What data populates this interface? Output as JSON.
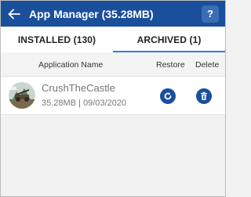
{
  "header": {
    "title": "App Manager (35.28MB)",
    "help_label": "?",
    "back_icon": "arrow-left-icon"
  },
  "tabs": [
    {
      "label": "INSTALLED (130)",
      "active": false
    },
    {
      "label": "ARCHIVED (1)",
      "active": true
    }
  ],
  "table": {
    "columns": {
      "name": "Application Name",
      "restore": "Restore",
      "delete": "Delete"
    },
    "rows": [
      {
        "name": "CrushTheCastle",
        "meta": "35.28MB | 09/03/2020",
        "icon": "castle-game-icon",
        "restore_icon": "restore-icon",
        "delete_icon": "trash-icon"
      }
    ]
  },
  "colors": {
    "primary": "#1a4f9c",
    "tab_indicator": "#2d7ee0"
  }
}
